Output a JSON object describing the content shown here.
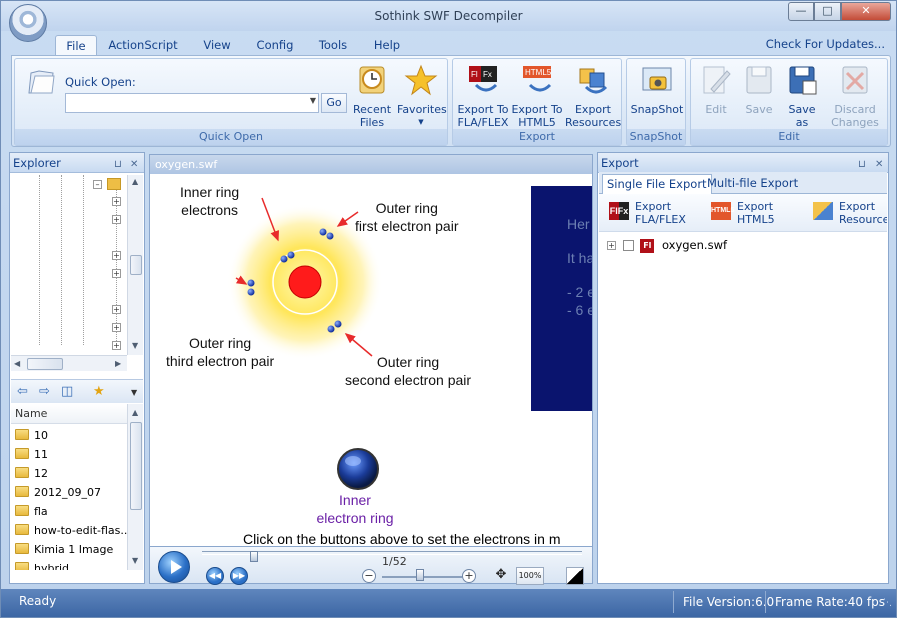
{
  "window": {
    "title": "Sothink SWF Decompiler"
  },
  "ribbon_tabs": [
    "File",
    "ActionScript",
    "View",
    "Config",
    "Tools",
    "Help"
  ],
  "check_updates": "Check For Updates...",
  "quick_open": {
    "label": "Quick Open:",
    "go": "Go",
    "recent": "Recent Files",
    "favorites": "Favorites",
    "group": "Quick Open"
  },
  "export_group": {
    "fla": "Export To FLA/FLEX",
    "html5": "Export To HTML5",
    "resources": "Export Resources",
    "group": "Export"
  },
  "snapshot_group": {
    "snapshot": "SnapShot",
    "group": "SnapShot"
  },
  "edit_group": {
    "edit": "Edit",
    "save": "Save",
    "save_as": "Save as",
    "discard": "Discard Changes",
    "group": "Edit"
  },
  "explorer": {
    "title": "Explorer",
    "column_name": "Name",
    "files": [
      "10",
      "11",
      "12",
      "2012_09_07",
      "fla",
      "how-to-edit-flas...",
      "Kimia 1 Image",
      "hybrid"
    ]
  },
  "document": {
    "tab": "oxygen.swf",
    "labels": {
      "inner_ring_electrons": "Inner ring\nelectrons",
      "outer_first": "Outer ring\nfirst electron pair",
      "outer_third": "Outer ring\nthird electron pair",
      "outer_second": "Outer ring\nsecond electron pair",
      "inner_button": "Inner\nelectron ring",
      "instruction": "Click on the buttons above to set the electrons in m",
      "box_lines": [
        "Her",
        "It ha",
        "- 2 e",
        "- 6 e"
      ]
    }
  },
  "player": {
    "frame": "1/52",
    "zoom_badge": "100%"
  },
  "export_panel": {
    "title": "Export",
    "tabs": [
      "Single File Export",
      "Multi-file Export"
    ],
    "fla": "Export\nFLA/FLEX",
    "html5": "Export\nHTML5",
    "resources": "Export\nResources",
    "file": "oxygen.swf",
    "fl_badge": "Fl"
  },
  "status": {
    "text": "Ready",
    "file_version": "File Version:6.0",
    "frame_rate": "Frame Rate:40 fps"
  },
  "colors": {
    "accent": "#15428b",
    "status_bar": "#4a73b0",
    "nucleus": "#ff1b1b",
    "blue_box": "#0a146e"
  }
}
